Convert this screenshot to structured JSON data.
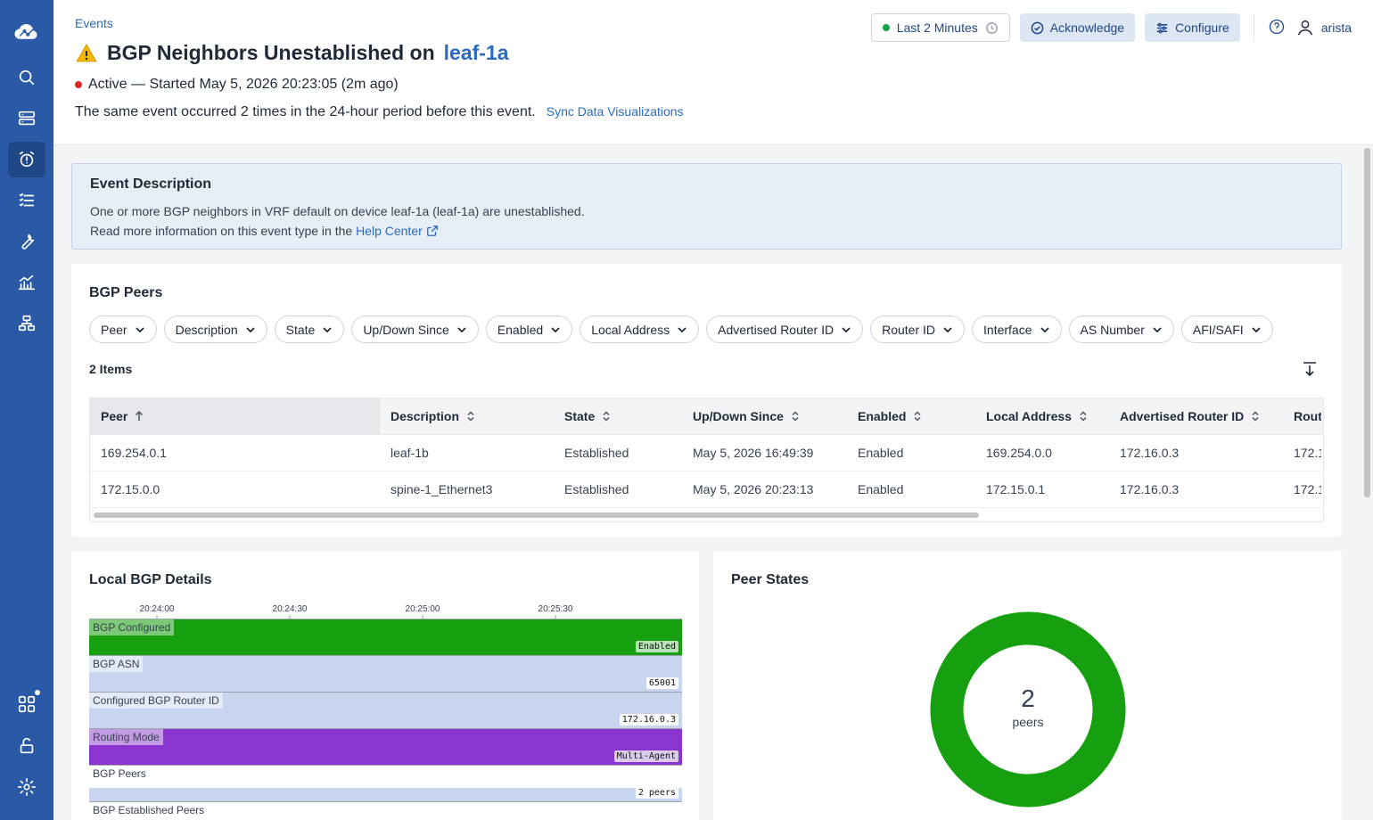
{
  "sidebar": {
    "items": [
      {
        "icon": "cloud-logo-icon",
        "name": "home-logo"
      },
      {
        "icon": "search-icon",
        "name": "search"
      },
      {
        "icon": "devices-icon",
        "name": "devices"
      },
      {
        "icon": "alarm-icon",
        "name": "events"
      },
      {
        "icon": "tasks-icon",
        "name": "tasks"
      },
      {
        "icon": "wrench-icon",
        "name": "provisioning"
      },
      {
        "icon": "dashboard-icon",
        "name": "dashboards"
      },
      {
        "icon": "topology-icon",
        "name": "topology"
      },
      {
        "icon": "apps-icon",
        "name": "apps"
      },
      {
        "icon": "unlock-icon",
        "name": "lock"
      },
      {
        "icon": "gear-icon",
        "name": "settings"
      }
    ]
  },
  "header": {
    "breadcrumb": "Events",
    "title_prefix": "BGP Neighbors Unestablished on",
    "title_device": "leaf-1a",
    "status": "Active — Started May 5, 2026 20:23:05 (2m ago)",
    "occurrence_text": "The same event occurred 2 times in the 24-hour period before this event.",
    "sync_link": "Sync Data Visualizations",
    "time_range": "Last 2 Minutes",
    "acknowledge": "Acknowledge",
    "configure": "Configure",
    "user": "arista"
  },
  "description": {
    "title": "Event Description",
    "line1": "One or more BGP neighbors in VRF default on device leaf-1a (leaf-1a) are unestablished.",
    "line2_prefix": "Read more information on this event type in the",
    "help_link": "Help Center"
  },
  "peers": {
    "title": "BGP Peers",
    "filters": [
      "Peer",
      "Description",
      "State",
      "Up/Down Since",
      "Enabled",
      "Local Address",
      "Advertised Router ID",
      "Router ID",
      "Interface",
      "AS Number",
      "AFI/SAFI"
    ],
    "count": "2 Items",
    "columns": [
      "Peer",
      "Description",
      "State",
      "Up/Down Since",
      "Enabled",
      "Local Address",
      "Advertised Router ID",
      "Route"
    ],
    "rows": [
      [
        "169.254.0.1",
        "leaf-1b",
        "Established",
        "May 5, 2026 16:49:39",
        "Enabled",
        "169.254.0.0",
        "172.16.0.3",
        "172.1"
      ],
      [
        "172.15.0.0",
        "spine-1_Ethernet3",
        "Established",
        "May 5, 2026 20:23:13",
        "Enabled",
        "172.15.0.1",
        "172.16.0.3",
        "172.1"
      ]
    ]
  },
  "local_bgp": {
    "title": "Local BGP Details",
    "ticks": [
      "20:24:00",
      "20:24:30",
      "20:25:00",
      "20:25:30"
    ],
    "lanes": [
      {
        "label": "BGP Configured",
        "value": "Enabled",
        "color": "#16a010"
      },
      {
        "label": "BGP ASN",
        "value": "65001",
        "color": "#c7d5ef"
      },
      {
        "label": "Configured BGP Router ID",
        "value": "172.16.0.3",
        "color": "#c7d5ef"
      },
      {
        "label": "Routing Mode",
        "value": "Multi-Agent",
        "color": "#8a35cf"
      },
      {
        "label": "BGP Peers",
        "value": "2 peers",
        "color": "#c7d5ef"
      },
      {
        "label": "BGP Established Peers",
        "value": "",
        "color": "#c7d5ef"
      }
    ]
  },
  "peer_states": {
    "title": "Peer States",
    "total": "2",
    "unit": "peers",
    "color": "#16a010"
  }
}
